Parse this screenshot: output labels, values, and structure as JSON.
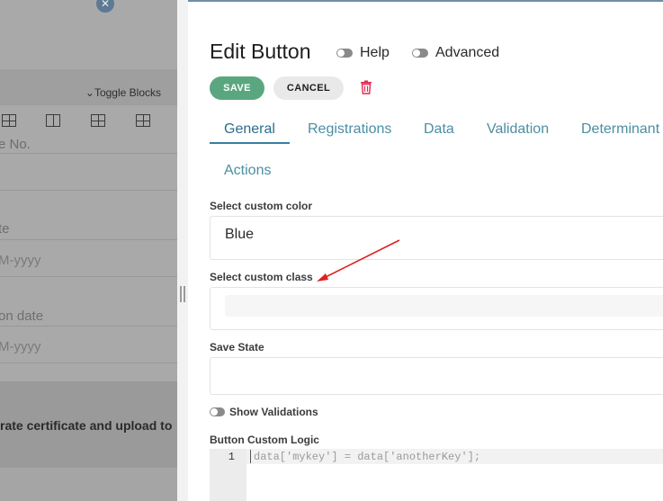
{
  "background_editor": {
    "toggle_blocks_label": "Toggle Blocks",
    "field_fragment_1": "e No.",
    "field_fragment_2": "te",
    "placeholder_1": "M-yyyy",
    "field_fragment_3": "on date",
    "placeholder_2": "M-yyyy",
    "certificate_text": "rate certificate and upload to"
  },
  "modal": {
    "title": "Edit Button",
    "help_toggle_label": "Help",
    "advanced_toggle_label": "Advanced",
    "save_label": "SAVE",
    "cancel_label": "CANCEL",
    "tabs": [
      {
        "label": "General",
        "active": true
      },
      {
        "label": "Registrations",
        "active": false
      },
      {
        "label": "Data",
        "active": false
      },
      {
        "label": "Validation",
        "active": false
      },
      {
        "label": "Determinant",
        "active": false
      },
      {
        "label": "Actions",
        "active": false
      }
    ],
    "fields": {
      "custom_color_label": "Select custom color",
      "custom_color_value": "Blue",
      "custom_class_label": "Select custom class",
      "custom_class_value": "",
      "save_state_label": "Save State",
      "save_state_value": "",
      "show_validations_label": "Show Validations",
      "button_logic_label": "Button Custom Logic"
    },
    "code_editor": {
      "line_number": "1",
      "code": "data['mykey'] = data['anotherKey'];"
    }
  },
  "colors": {
    "save_button": "#5aa77f",
    "tab_text": "#4b8ea3",
    "tab_active_underline": "#3a7ea0",
    "delete_icon": "#e0284f",
    "annotation_arrow": "#e02020"
  }
}
